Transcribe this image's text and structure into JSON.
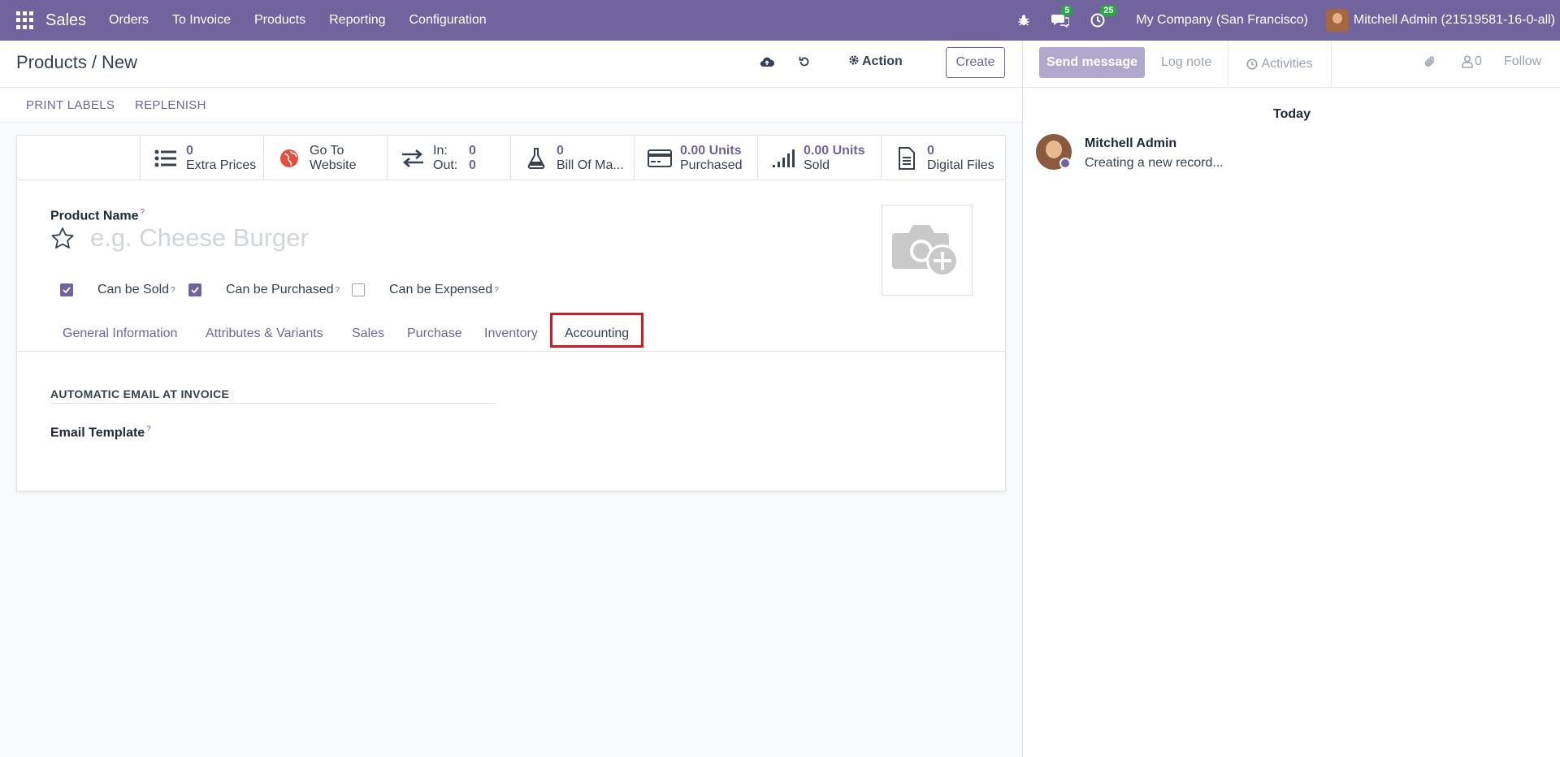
{
  "navbar": {
    "app_name": "Sales",
    "menu": [
      "Orders",
      "To Invoice",
      "Products",
      "Reporting",
      "Configuration"
    ],
    "messages_badge": "5",
    "activities_badge": "25",
    "company": "My Company (San Francisco)",
    "user": "Mitchell Admin (21519581-16-0-all)",
    "accent_color": "#71639e"
  },
  "control_panel": {
    "breadcrumb_parent": "Products",
    "breadcrumb_separator": "/",
    "breadcrumb_current": "New",
    "action_label": "Action",
    "create_label": "Create"
  },
  "header_buttons": {
    "print_labels": "PRINT LABELS",
    "replenish": "REPLENISH"
  },
  "stats": {
    "extra_prices_value": "0",
    "extra_prices_label": "Extra Prices",
    "website_line1": "Go To",
    "website_line2": "Website",
    "in_label": "In:",
    "in_value": "0",
    "out_label": "Out:",
    "out_value": "0",
    "bom_value": "0",
    "bom_label": "Bill Of Ma...",
    "purchased_value": "0.00 Units",
    "purchased_label": "Purchased",
    "sold_value": "0.00 Units",
    "sold_label": "Sold",
    "files_value": "0",
    "files_label": "Digital Files"
  },
  "form": {
    "product_name_label": "Product Name",
    "help_mark": "?",
    "product_name_placeholder": "e.g. Cheese Burger",
    "can_be_sold": {
      "label": "Can be Sold",
      "checked": true
    },
    "can_be_purchased": {
      "label": "Can be Purchased",
      "checked": true
    },
    "can_be_expensed": {
      "label": "Can be Expensed",
      "checked": false
    }
  },
  "tabs": [
    "General Information",
    "Attributes & Variants",
    "Sales",
    "Purchase",
    "Inventory",
    "Accounting"
  ],
  "active_tab": "Accounting",
  "highlight_color": "#e0131a",
  "accounting": {
    "section_title": "AUTOMATIC EMAIL AT INVOICE",
    "email_template_label": "Email Template"
  },
  "chatter": {
    "send_message": "Send message",
    "log_note": "Log note",
    "activities": "Activities",
    "followers_count": "0",
    "follow": "Follow",
    "date_separator": "Today",
    "message_author": "Mitchell Admin",
    "message_body": "Creating a new record..."
  }
}
